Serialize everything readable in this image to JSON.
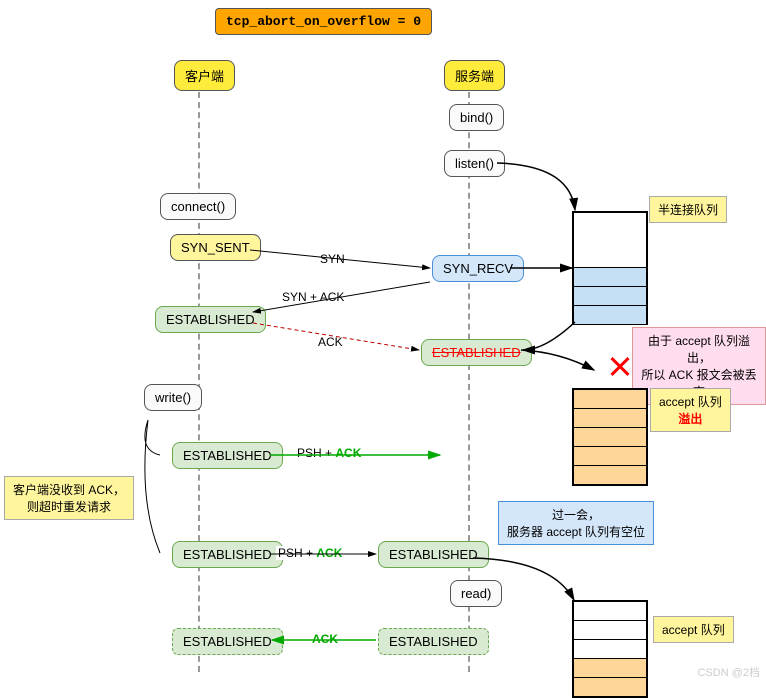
{
  "title": "tcp_abort_on_overflow = 0",
  "client": "客户端",
  "server": "服务端",
  "bind": "bind()",
  "listen": "listen()",
  "connect": "connect()",
  "write": "write()",
  "read": "read)",
  "syn_sent": "SYN_SENT",
  "syn_recv": "SYN_RECV",
  "established": "ESTABLISHED",
  "syn": "SYN",
  "synack": "SYN + ACK",
  "ack": "ACK",
  "pshack_psh": "PSH + ",
  "ack_word": "ACK",
  "half_queue": "半连接队列",
  "drop_note1": "由于 accept 队列溢出，",
  "drop_note2": "所以 ACK 报文会被丢弃",
  "accept_queue": "accept 队列",
  "overflow": "溢出",
  "retry1": "客户端没收到 ACK，",
  "retry2": "则超时重发请求",
  "later1": "过一会，",
  "later2": "服务器 accept 队列有空位",
  "watermark": "CSDN @2档"
}
